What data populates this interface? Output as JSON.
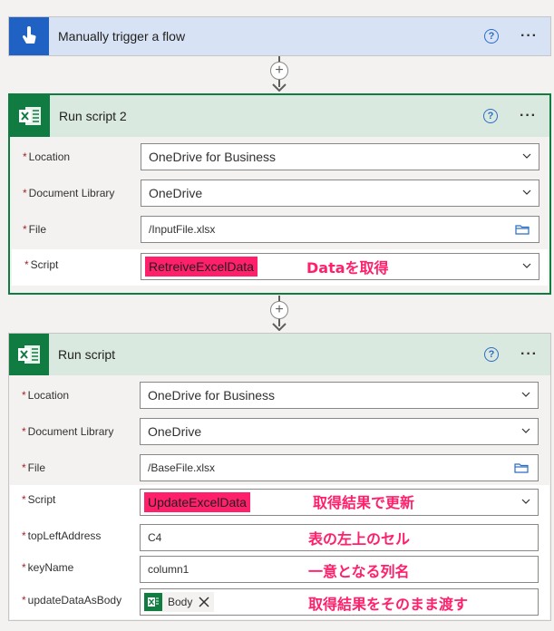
{
  "trigger": {
    "title": "Manually trigger a flow",
    "help": "?",
    "more": "···"
  },
  "script2": {
    "title": "Run script 2",
    "help": "?",
    "more": "···",
    "fields": {
      "location": {
        "label": "Location",
        "value": "OneDrive for Business"
      },
      "library": {
        "label": "Document Library",
        "value": "OneDrive"
      },
      "file": {
        "label": "File",
        "value": "/InputFile.xlsx"
      },
      "script": {
        "label": "Script",
        "value": "RetreiveExcelData",
        "note": "Dataを取得"
      }
    }
  },
  "script1": {
    "title": "Run script",
    "help": "?",
    "more": "···",
    "fields": {
      "location": {
        "label": "Location",
        "value": "OneDrive for Business"
      },
      "library": {
        "label": "Document Library",
        "value": "OneDrive"
      },
      "file": {
        "label": "File",
        "value": "/BaseFile.xlsx"
      },
      "script": {
        "label": "Script",
        "value": "UpdateExcelData",
        "note": "取得結果で更新"
      },
      "topLeft": {
        "label": "topLeftAddress",
        "value": "C4",
        "note": "表の左上のセル"
      },
      "keyName": {
        "label": "keyName",
        "value": "column1",
        "note": "一意となる列名"
      },
      "updateData": {
        "label": "updateDataAsBody",
        "token": "Body",
        "note": "取得結果をそのまま渡す"
      }
    }
  },
  "required_marker": "*",
  "plus": "+",
  "colors": {
    "excel_green": "#107c41",
    "trigger_blue": "#1f62c4",
    "highlight": "#ff1f6b"
  },
  "icons": {
    "trigger": "touch-hand-icon",
    "excel": "excel-icon",
    "folder": "folder-icon",
    "chevron": "chevron-down-icon",
    "remove": "close-icon"
  }
}
